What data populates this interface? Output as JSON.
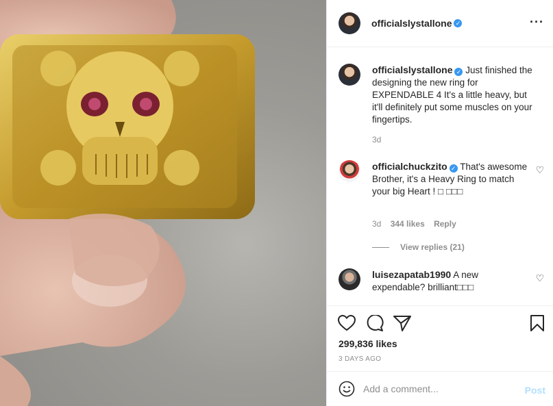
{
  "post": {
    "author": "officialslystallone",
    "caption": "Just finished the designing the new ring for EXPENDABLE 4 It's a little heavy, but it'll definitely put some muscles on your fingertips.",
    "caption_time": "3d",
    "likes": "299,836 likes",
    "date": "3 DAYS AGO"
  },
  "comments": [
    {
      "user": "officialchuckzito",
      "text": "That's awesome Brother, it's a Heavy Ring to match your big Heart ! □ □□□",
      "time": "3d",
      "likes": "344 likes",
      "reply": "Reply",
      "view_replies": "View replies (21)"
    },
    {
      "user": "luisezapatab1990",
      "text": "A new expendable? brilliant□□□"
    }
  ],
  "add_comment": {
    "placeholder": "Add a comment...",
    "post_label": "Post"
  },
  "colors": {
    "verified": "#3897f0",
    "post_disabled": "#b2dffc",
    "gold": "#c9a233"
  },
  "icons": [
    "verified-badge-icon",
    "more-options-icon",
    "heart-icon",
    "comment-icon",
    "share-icon",
    "save-icon",
    "emoji-icon"
  ]
}
